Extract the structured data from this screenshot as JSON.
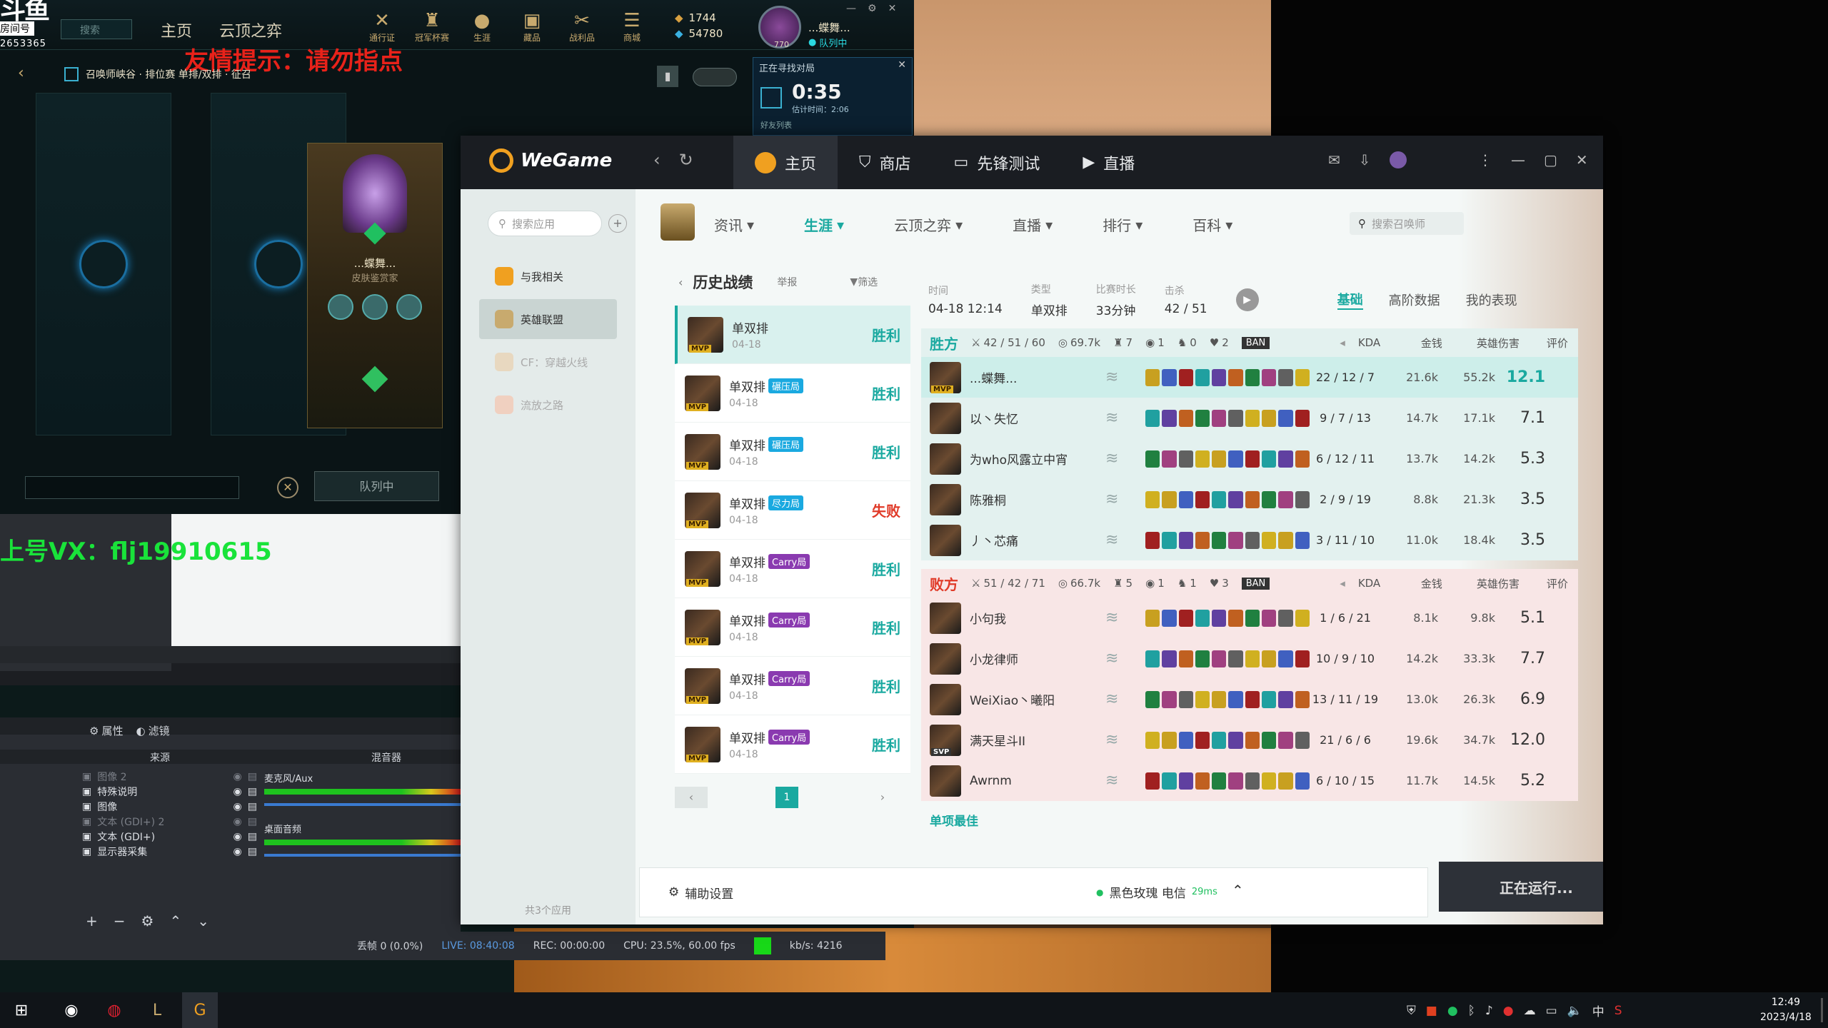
{
  "lol": {
    "nav": [
      "主页",
      "云顶之弈"
    ],
    "top_icons": [
      "通行证",
      "冠军杯赛",
      "生涯",
      "藏品",
      "战利品",
      "商城"
    ],
    "currency_rp": "1744",
    "currency_be": "54780",
    "summoner_level": "770",
    "summoner_name": "...蝶舞...",
    "summoner_status": "队列中",
    "room_number": "2653365",
    "room_label": "房间号",
    "search_placeholder": "搜索",
    "mode_line": "召唤师峡谷 · 排位赛 单排/双排 · 征召",
    "warning": "友情提示：请勿指点",
    "player_name": "...蝶舞...",
    "player_subtitle": "皮肤鉴赏家",
    "queue_button": "队列中",
    "queue_box_title": "正在寻找对局",
    "queue_time": "0:35",
    "queue_estimate": "估计时间：2:06",
    "friend_list": "好友列表"
  },
  "vx_banner": "上号VX：flj19910615",
  "obs": {
    "tabs": [
      "属性",
      "滤镜"
    ],
    "sources_header": "来源",
    "mixer_header": "混音器",
    "sources": [
      {
        "label": "图像 2",
        "dim": true
      },
      {
        "label": "特殊说明",
        "dim": false
      },
      {
        "label": "图像",
        "dim": false
      },
      {
        "label": "文本 (GDI+) 2",
        "dim": true
      },
      {
        "label": "文本 (GDI+)",
        "dim": false
      },
      {
        "label": "显示器采集",
        "dim": false
      }
    ],
    "mixer": [
      "麦克风/Aux",
      "桌面音频"
    ],
    "status": {
      "dropped": "丢帧 0 (0.0%)",
      "live": "LIVE: 08:40:08",
      "rec": "REC: 00:00:00",
      "cpu": "CPU: 23.5%, 60.00 fps",
      "kbs": "kb/s: 4216"
    }
  },
  "wegame": {
    "logo": "WeGame",
    "tabs": [
      "主页",
      "商店",
      "先锋测试",
      "直播"
    ],
    "sidebar": {
      "search_placeholder": "搜索应用",
      "items": [
        "与我相关",
        "英雄联盟",
        "CF：穿越火线",
        "流放之路"
      ],
      "footer": "共3个应用"
    },
    "subnav": [
      "资讯",
      "生涯",
      "云顶之弈",
      "直播",
      "排行",
      "百科"
    ],
    "summoner_search_placeholder": "搜索召唤师",
    "history": {
      "title": "历史战绩",
      "report": "举报",
      "filter": "筛选",
      "items": [
        {
          "mode": "单双排",
          "badge": "",
          "date": "04-18",
          "result": "胜利",
          "win": true
        },
        {
          "mode": "单双排",
          "badge": "碾压局",
          "date": "04-18",
          "result": "胜利",
          "win": true
        },
        {
          "mode": "单双排",
          "badge": "碾压局",
          "date": "04-18",
          "result": "胜利",
          "win": true
        },
        {
          "mode": "单双排",
          "badge": "尽力局",
          "date": "04-18",
          "result": "失败",
          "win": false
        },
        {
          "mode": "单双排",
          "badge": "Carry局",
          "date": "04-18",
          "result": "胜利",
          "win": true
        },
        {
          "mode": "单双排",
          "badge": "Carry局",
          "date": "04-18",
          "result": "胜利",
          "win": true
        },
        {
          "mode": "单双排",
          "badge": "Carry局",
          "date": "04-18",
          "result": "胜利",
          "win": true
        },
        {
          "mode": "单双排",
          "badge": "Carry局",
          "date": "04-18",
          "result": "胜利",
          "win": true
        }
      ],
      "page": "1"
    },
    "match": {
      "labels": {
        "time": "时间",
        "type": "类型",
        "duration": "比赛时长",
        "kills": "击杀"
      },
      "time": "04-18 12:14",
      "type": "单双排",
      "duration": "33分钟",
      "kills": "42 / 51",
      "view_tabs": [
        "基础",
        "高阶数据",
        "我的表现"
      ],
      "col_headers": [
        "KDA",
        "金钱",
        "英雄伤害",
        "评价"
      ],
      "ban": "BAN",
      "win_team": {
        "label": "胜方",
        "kda": "42 / 51 / 60",
        "gold": "69.7k",
        "towers": "7",
        "inhib": "1",
        "baron": "0",
        "dragon": "2",
        "players": [
          {
            "name": "...蝶舞...",
            "kda": "22 / 12 / 7",
            "gold": "21.6k",
            "dmg": "55.2k",
            "score": "12.1",
            "mvp": true
          },
          {
            "name": "以丶失忆",
            "kda": "9 / 7 / 13",
            "gold": "14.7k",
            "dmg": "17.1k",
            "score": "7.1"
          },
          {
            "name": "为who风露立中宵",
            "kda": "6 / 12 / 11",
            "gold": "13.7k",
            "dmg": "14.2k",
            "score": "5.3"
          },
          {
            "name": "陈雅桐",
            "kda": "2 / 9 / 19",
            "gold": "8.8k",
            "dmg": "21.3k",
            "score": "3.5"
          },
          {
            "name": "丿丶芯痛",
            "kda": "3 / 11 / 10",
            "gold": "11.0k",
            "dmg": "18.4k",
            "score": "3.5"
          }
        ]
      },
      "lose_team": {
        "label": "败方",
        "kda": "51 / 42 / 71",
        "gold": "66.7k",
        "towers": "5",
        "inhib": "1",
        "baron": "1",
        "dragon": "3",
        "players": [
          {
            "name": "小句我",
            "kda": "1 / 6 / 21",
            "gold": "8.1k",
            "dmg": "9.8k",
            "score": "5.1"
          },
          {
            "name": "小龙律师",
            "kda": "10 / 9 / 10",
            "gold": "14.2k",
            "dmg": "33.3k",
            "score": "7.7"
          },
          {
            "name": "WeiXiao丶曦阳",
            "kda": "13 / 11 / 19",
            "gold": "13.0k",
            "dmg": "26.3k",
            "score": "6.9"
          },
          {
            "name": "满天星斗II",
            "kda": "21 / 6 / 6",
            "gold": "19.6k",
            "dmg": "34.7k",
            "score": "12.0",
            "sup": true
          },
          {
            "name": "Awrnm",
            "kda": "6 / 10 / 15",
            "gold": "11.7k",
            "dmg": "14.5k",
            "score": "5.2"
          }
        ]
      },
      "single_best": "单项最佳"
    },
    "bottom": {
      "assist": "辅助设置",
      "server": "黑色玫瑰 电信",
      "ping": "29ms",
      "running": "正在运行..."
    }
  },
  "taskbar": {
    "time": "12:49",
    "date": "2023/4/18",
    "ime": "中"
  },
  "colors": {
    "accent": "#1aa9a0",
    "win_bg": "#e3f1ef",
    "lose_bg": "#f8e6e6",
    "loss": "#e03a28"
  }
}
